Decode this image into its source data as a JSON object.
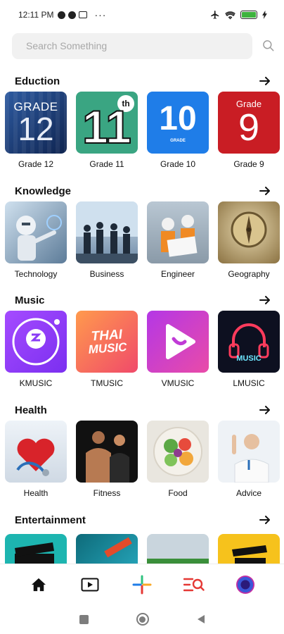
{
  "status": {
    "time": "12:11 PM"
  },
  "search": {
    "placeholder": "Search Something"
  },
  "sections": [
    {
      "title": "Eduction",
      "items": [
        {
          "label": "Grade 12",
          "art": "GRADE 12"
        },
        {
          "label": "Grade 11",
          "art": "11th"
        },
        {
          "label": "Grade 10",
          "art": "10"
        },
        {
          "label": "Grade 9",
          "art": "Grade 9"
        }
      ]
    },
    {
      "title": "Knowledge",
      "items": [
        {
          "label": "Technology"
        },
        {
          "label": "Business"
        },
        {
          "label": "Engineer"
        },
        {
          "label": "Geography"
        }
      ]
    },
    {
      "title": "Music",
      "items": [
        {
          "label": "KMUSIC",
          "art": "kmusic-logo"
        },
        {
          "label": "TMUSIC",
          "art": "THAI MUSIC"
        },
        {
          "label": "VMUSIC",
          "art": "vmusic-logo"
        },
        {
          "label": "LMUSIC",
          "art": "MUSIC"
        }
      ]
    },
    {
      "title": "Health",
      "items": [
        {
          "label": "Health"
        },
        {
          "label": "Fitness"
        },
        {
          "label": "Food"
        },
        {
          "label": "Advice"
        }
      ]
    },
    {
      "title": "Entertainment",
      "items": [
        {
          "label": ""
        },
        {
          "label": ""
        },
        {
          "label": ""
        },
        {
          "label": ""
        }
      ]
    }
  ],
  "art_text": {
    "grade12_top": "GRADE",
    "grade12_num": "12",
    "grade11_num": "11",
    "grade11_sup": "th",
    "grade10_num": "10",
    "grade10_sub": "GRADE",
    "grade9_top": "Grade",
    "grade9_num": "9",
    "thai": "THAI",
    "music": "MUSIC",
    "lmusic": "MUSIC"
  },
  "bottom_nav": [
    {
      "name": "home-icon"
    },
    {
      "name": "video-icon"
    },
    {
      "name": "plus-icon"
    },
    {
      "name": "search-list-icon"
    },
    {
      "name": "profile-avatar"
    }
  ],
  "colors": {
    "accent_red": "#e53935",
    "grade12": "#1b3a73",
    "grade11": "#3aa582",
    "grade10": "#1f7de8",
    "grade9": "#c91d24"
  }
}
